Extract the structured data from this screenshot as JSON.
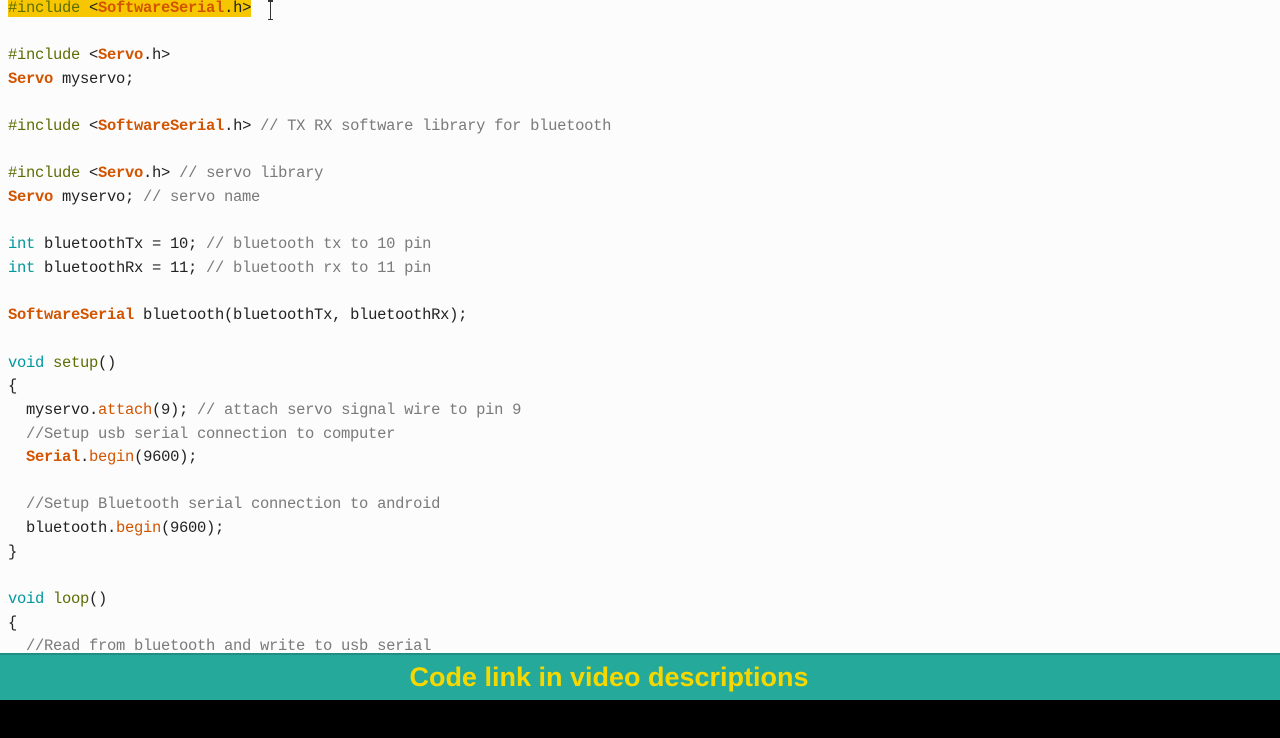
{
  "editor": {
    "language": "arduino-cpp",
    "lines": [
      [
        {
          "t": "#include ",
          "c": "preproc",
          "hl": true
        },
        {
          "t": "<",
          "c": "plain",
          "hl": true
        },
        {
          "t": "SoftwareSerial",
          "c": "lib",
          "hl": true
        },
        {
          "t": ".h>",
          "c": "plain",
          "hl": true
        }
      ],
      [],
      [
        {
          "t": "#include ",
          "c": "preproc"
        },
        {
          "t": "<",
          "c": "plain"
        },
        {
          "t": "Servo",
          "c": "lib"
        },
        {
          "t": ".h>",
          "c": "plain"
        }
      ],
      [
        {
          "t": "Servo",
          "c": "lib"
        },
        {
          "t": " myservo;",
          "c": "plain"
        }
      ],
      [],
      [
        {
          "t": "#include ",
          "c": "preproc"
        },
        {
          "t": "<",
          "c": "plain"
        },
        {
          "t": "SoftwareSerial",
          "c": "lib"
        },
        {
          "t": ".h>",
          "c": "plain"
        },
        {
          "t": " // TX RX software library for bluetooth",
          "c": "comment"
        }
      ],
      [],
      [
        {
          "t": "#include ",
          "c": "preproc"
        },
        {
          "t": "<",
          "c": "plain"
        },
        {
          "t": "Servo",
          "c": "lib"
        },
        {
          "t": ".h>",
          "c": "plain"
        },
        {
          "t": " // servo library",
          "c": "comment"
        }
      ],
      [
        {
          "t": "Servo",
          "c": "lib"
        },
        {
          "t": " myservo;",
          "c": "plain"
        },
        {
          "t": " // servo name",
          "c": "comment"
        }
      ],
      [],
      [
        {
          "t": "int",
          "c": "type"
        },
        {
          "t": " bluetoothTx = 10;",
          "c": "plain"
        },
        {
          "t": " // bluetooth tx to 10 pin",
          "c": "comment"
        }
      ],
      [
        {
          "t": "int",
          "c": "type"
        },
        {
          "t": " bluetoothRx = 11;",
          "c": "plain"
        },
        {
          "t": " // bluetooth rx to 11 pin",
          "c": "comment"
        }
      ],
      [],
      [
        {
          "t": "SoftwareSerial",
          "c": "lib"
        },
        {
          "t": " bluetooth(bluetoothTx, bluetoothRx);",
          "c": "plain"
        }
      ],
      [],
      [
        {
          "t": "void",
          "c": "type"
        },
        {
          "t": " ",
          "c": "plain"
        },
        {
          "t": "setup",
          "c": "func"
        },
        {
          "t": "()",
          "c": "plain"
        }
      ],
      [
        {
          "t": "{",
          "c": "plain"
        }
      ],
      [
        {
          "t": "  myservo.",
          "c": "plain"
        },
        {
          "t": "attach",
          "c": "method"
        },
        {
          "t": "(9);",
          "c": "plain"
        },
        {
          "t": " // attach servo signal wire to pin 9",
          "c": "comment"
        }
      ],
      [
        {
          "t": "  //Setup usb serial connection to computer",
          "c": "comment"
        }
      ],
      [
        {
          "t": "  ",
          "c": "plain"
        },
        {
          "t": "Serial",
          "c": "lib"
        },
        {
          "t": ".",
          "c": "plain"
        },
        {
          "t": "begin",
          "c": "method"
        },
        {
          "t": "(9600);",
          "c": "plain"
        }
      ],
      [],
      [
        {
          "t": "  //Setup Bluetooth serial connection to android",
          "c": "comment"
        }
      ],
      [
        {
          "t": "  bluetooth.",
          "c": "plain"
        },
        {
          "t": "begin",
          "c": "method"
        },
        {
          "t": "(9600);",
          "c": "plain"
        }
      ],
      [
        {
          "t": "}",
          "c": "plain"
        }
      ],
      [],
      [
        {
          "t": "void",
          "c": "type"
        },
        {
          "t": " ",
          "c": "plain"
        },
        {
          "t": "loop",
          "c": "func"
        },
        {
          "t": "()",
          "c": "plain"
        }
      ],
      [
        {
          "t": "{",
          "c": "plain"
        }
      ],
      [
        {
          "t": "  //Read from bluetooth and write to usb serial",
          "c": "comment"
        }
      ]
    ]
  },
  "banner": {
    "text": "Code link in video descriptions"
  },
  "colors": {
    "preproc": "#5e6d03",
    "lib": "#d35400",
    "type": "#00979c",
    "method": "#d35400",
    "comment": "#7a7a7a",
    "highlight": "#f6c700",
    "banner_bg": "#25a99b",
    "banner_text": "#f5d800"
  }
}
